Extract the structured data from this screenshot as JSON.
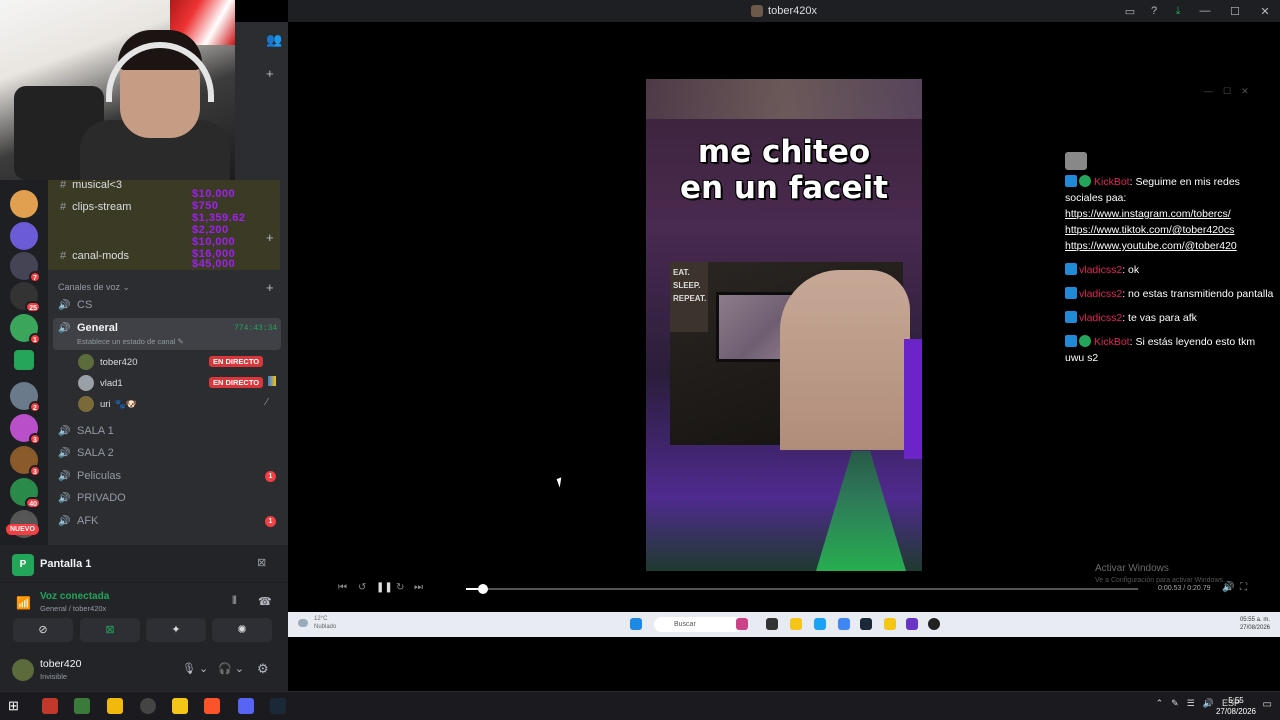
{
  "window": {
    "title": "tober420x"
  },
  "channels_text": [
    {
      "label": "musical<3"
    },
    {
      "label": "clips-stream"
    },
    {
      "label": "canal-mods"
    }
  ],
  "donation_overlay": {
    "lines": [
      "$10.000",
      "$750",
      "$1,359.62",
      "$2,200",
      "$10,000",
      "$16,000",
      "$45,000"
    ]
  },
  "voice_category": {
    "label": "Canales de voz"
  },
  "voice_channels": [
    {
      "label": "CS"
    },
    {
      "label": "General",
      "timer": "774:43:34",
      "status": "Establece un estado de canal"
    },
    {
      "label": "SALA 1"
    },
    {
      "label": "SALA 2"
    },
    {
      "label": "Peliculas",
      "badge": "1"
    },
    {
      "label": "PRIVADO"
    },
    {
      "label": "AFK",
      "badge": "1"
    }
  ],
  "voice_users": [
    {
      "name": "tober420",
      "live": "EN DIRECTO"
    },
    {
      "name": "vlad1",
      "live": "EN DIRECTO"
    },
    {
      "name": "uri"
    }
  ],
  "server_badges": [
    "7",
    "25",
    "1",
    "2",
    "3",
    "3",
    "40"
  ],
  "new_label": "NUEVO",
  "screen_share": {
    "label": "Pantalla 1"
  },
  "voice_status": {
    "title": "Voz conectada",
    "subtitle": "General / tober420x"
  },
  "user_panel": {
    "name": "tober420",
    "status": "Invisible"
  },
  "video": {
    "caption_line1": "me chiteo",
    "caption_line2": "en un faceit",
    "poster": [
      "EAT.",
      "SLEEP.",
      "",
      "REPEAT."
    ]
  },
  "chat": [
    {
      "user": "KickBot",
      "text": ": Seguime en mis redes sociales paa:",
      "links": [
        "https://www.instagram.com/tobercs/",
        "https://www.tiktok.com/@tober420cs",
        "https://www.youtube.com/@tober420"
      ]
    },
    {
      "user": "vladicss2",
      "text": ": ok"
    },
    {
      "user": "vladicss2",
      "text": ": no estas transmitiendo pantalla"
    },
    {
      "user": "vladicss2",
      "text": ": te vas para afk"
    },
    {
      "user": "KickBot",
      "text": ": Si estás leyendo esto tkm uwu s2"
    }
  ],
  "player": {
    "timecode": "0:00.53 / 0:20.79"
  },
  "watermark": {
    "title": "Activar Windows",
    "subtitle": "Ve a Configuración para activar Windows."
  },
  "inner_taskbar": {
    "search": "Buscar",
    "weather": "12°C",
    "weather_sub": "Nublado",
    "time": "05:55 a. m.",
    "date": "27/08/2026"
  },
  "taskbar": {
    "lang": "ESP",
    "time": "5:55",
    "date": "27/08/2026"
  },
  "colors": {
    "accent_live": "#da373c",
    "online": "#23a55a",
    "chat_user": "#e0245e"
  }
}
